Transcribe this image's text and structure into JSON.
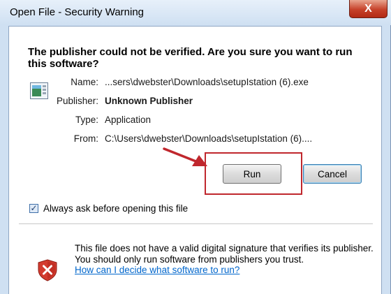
{
  "window": {
    "title": "Open File - Security Warning",
    "close_label": "X"
  },
  "heading": "The publisher could not be verified.  Are you sure you want to run this software?",
  "fields": {
    "name_label": "Name:",
    "name_value": "...sers\\dwebster\\Downloads\\setupIstation (6).exe",
    "publisher_label": "Publisher:",
    "publisher_value": "Unknown Publisher",
    "type_label": "Type:",
    "type_value": "Application",
    "from_label": "From:",
    "from_value": "C:\\Users\\dwebster\\Downloads\\setupIstation (6)...."
  },
  "buttons": {
    "run": "Run",
    "cancel": "Cancel"
  },
  "checkbox": {
    "label": "Always ask before opening this file",
    "checked": true
  },
  "warning": {
    "text": "This file does not have a valid digital signature that verifies its publisher.  You should only run software from publishers you trust.",
    "link": "How can I decide what software to run?"
  },
  "colors": {
    "highlight": "#c0272d",
    "link": "#0066cc",
    "shield_red": "#d33b2f"
  },
  "icons": {
    "app": "application-icon",
    "shield": "security-shield-icon",
    "arrow": "red-arrow-icon",
    "close": "close-icon"
  }
}
